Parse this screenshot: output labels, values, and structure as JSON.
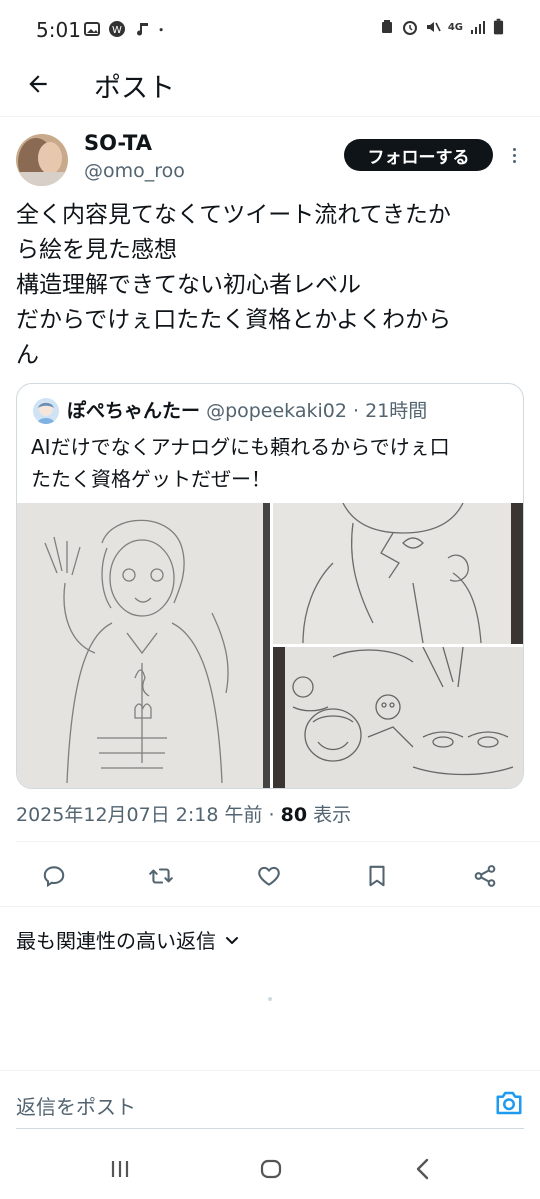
{
  "status_bar": {
    "time": "5:01",
    "left_icons": [
      "image-icon",
      "w-app-icon",
      "music-note-icon",
      "dot-icon"
    ],
    "right_icons": [
      "recycle-icon",
      "alarm-icon",
      "mute-icon",
      "network-4g-icon",
      "signal-icon",
      "battery-icon"
    ],
    "network_label": "4G"
  },
  "appbar": {
    "title": "ポスト"
  },
  "post": {
    "author_name": "SO-TA",
    "author_handle": "@omo_roo",
    "follow_label": "フォローする",
    "text_lines": [
      "全く内容見てなくてツイート流れてきたか",
      "ら絵を見た感想",
      "構造理解できてない初心者レベル",
      "だからでけぇ口たたく資格とかよくわから",
      "ん"
    ],
    "timestamp": "2025年12月07日 2:18 午前",
    "views_count": "80",
    "views_label": "表示"
  },
  "quote": {
    "author_name": "ぽぺちゃんたー",
    "author_handle": "@popeekaki02",
    "time_ago": "21時間",
    "text_lines": [
      "AIだけでなくアナログにも頼れるからでけぇ口",
      "たたく資格ゲットだぜー！"
    ]
  },
  "actions": [
    "reply-icon",
    "repost-icon",
    "like-icon",
    "bookmark-icon",
    "share-icon"
  ],
  "replies": {
    "sort_label": "最も関連性の高い返信"
  },
  "reply_bar": {
    "placeholder": "返信をポスト"
  },
  "colors": {
    "text": "#0f1419",
    "secondary": "#536471",
    "accent": "#1d9bf0",
    "border": "#cfd9de"
  }
}
